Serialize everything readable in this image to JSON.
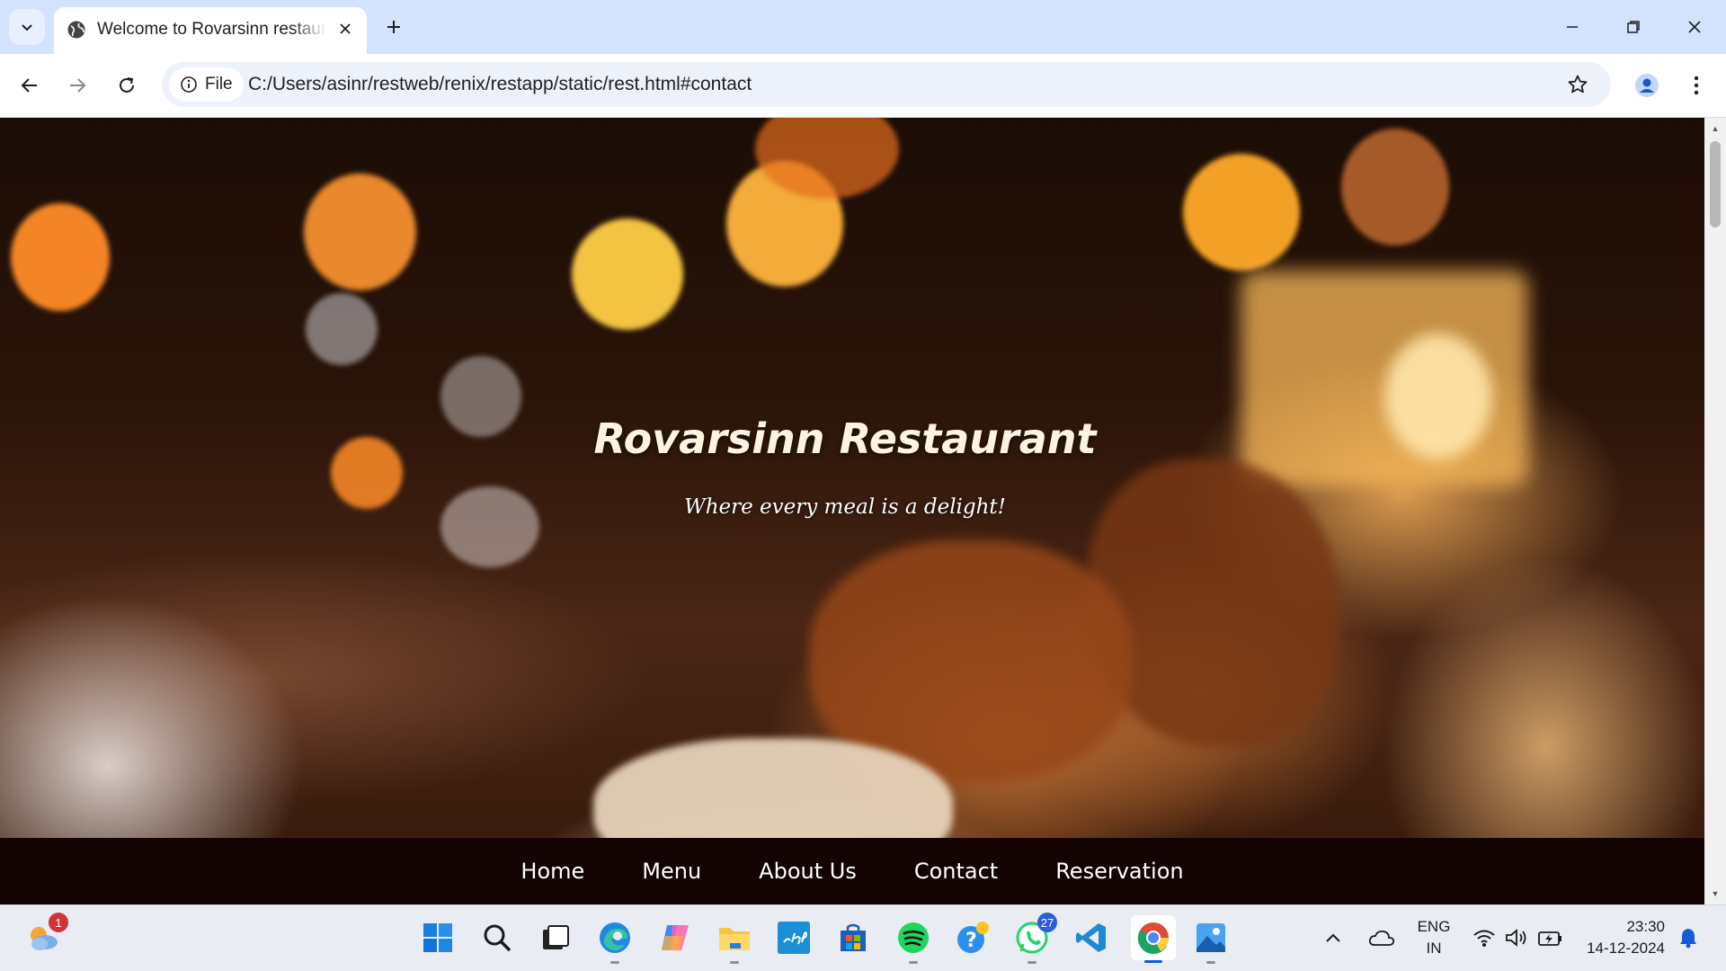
{
  "browser": {
    "tab_title": "Welcome to Rovarsinn restaurant",
    "new_tab_label": "+",
    "omnibox": {
      "chip_label": "File",
      "url": "C:/Users/asinr/restweb/renix/restapp/static/rest.html#contact"
    }
  },
  "hero": {
    "title": "Rovarsinn Restaurant",
    "tagline": "Where every meal is a delight!"
  },
  "nav": {
    "items": [
      {
        "label": "Home"
      },
      {
        "label": "Menu"
      },
      {
        "label": "About Us"
      },
      {
        "label": "Contact"
      },
      {
        "label": "Reservation"
      }
    ]
  },
  "taskbar": {
    "weather_badge": "1",
    "whatsapp_badge": "27",
    "language": "ENG",
    "region": "IN",
    "time": "23:30",
    "date": "14-12-2024"
  },
  "colors": {
    "tabstrip": "#d3e3fd",
    "navbar_bg": "#130303",
    "hero_title": "#fff4e0"
  }
}
